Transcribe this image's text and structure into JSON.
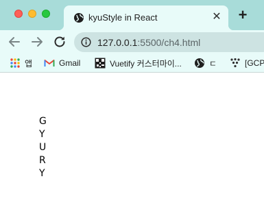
{
  "window": {
    "traffic_lights": [
      "close",
      "minimize",
      "maximize"
    ]
  },
  "tab": {
    "title": "kyuStyle in React",
    "favicon": "globe-icon",
    "close_icon": "close-icon"
  },
  "new_tab": {
    "label": "+"
  },
  "toolbar": {
    "back_icon": "arrow-left-icon",
    "forward_icon": "arrow-right-icon",
    "reload_icon": "reload-icon"
  },
  "address_bar": {
    "host": "127.0.0.1",
    "path": ":5500/ch4.html",
    "icon": "info-icon"
  },
  "bookmarks": [
    {
      "label": "앱",
      "icon": "apps-grid-icon"
    },
    {
      "label": "Gmail",
      "icon": "gmail-icon"
    },
    {
      "label": "Vuetify 커스터마이...",
      "icon": "vuetify-icon"
    },
    {
      "label": "ㄷ",
      "icon": "globe-icon"
    },
    {
      "label": "[GCP",
      "icon": "gcp-icon"
    }
  ],
  "page": {
    "letters": [
      "G",
      "Y",
      "U",
      "R",
      "Y"
    ]
  },
  "colors": {
    "tab_strip": "#a8dcd9",
    "toolbar": "#e8fbf9",
    "omnibox": "#cde3e2",
    "page_background": "#ffffff"
  }
}
